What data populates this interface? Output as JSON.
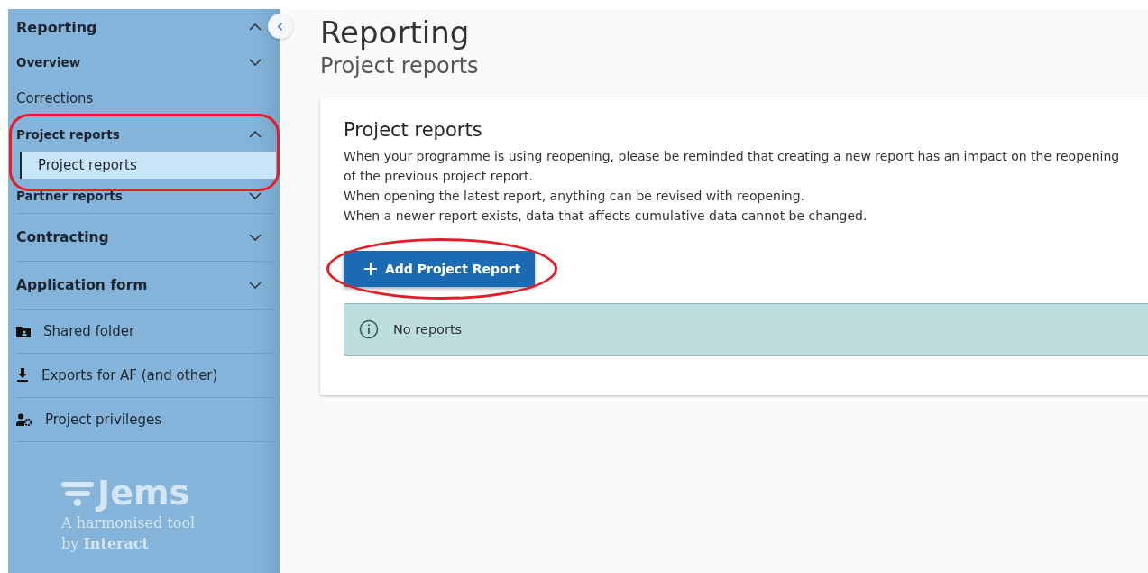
{
  "sidebar": {
    "sections": [
      {
        "label": "Reporting",
        "kind": "group",
        "expanded": true,
        "children": [
          {
            "label": "Overview",
            "kind": "group",
            "expanded": false
          },
          {
            "label": "Corrections",
            "kind": "link",
            "selected": false
          },
          {
            "label": "Project reports",
            "kind": "group",
            "expanded": true,
            "children": [
              {
                "label": "Project reports",
                "kind": "link",
                "selected": true
              }
            ]
          },
          {
            "label": "Partner reports",
            "kind": "group",
            "expanded": false
          }
        ]
      },
      {
        "label": "Contracting",
        "kind": "group",
        "expanded": false
      },
      {
        "label": "Application form",
        "kind": "group",
        "expanded": false
      },
      {
        "label": "Shared folder",
        "kind": "folder"
      },
      {
        "label": "Exports for AF (and other)",
        "kind": "download"
      },
      {
        "label": "Project privileges",
        "kind": "privileges"
      }
    ],
    "logo": {
      "name": "Jems",
      "tagline": [
        "A harmonised tool",
        "by **Interact**"
      ]
    }
  },
  "page": {
    "title": "Reporting",
    "subtitle": "Project reports"
  },
  "card": {
    "heading": "Project reports",
    "paragraphs": [
      "When your programme is using reopening, please be reminded that creating a new report has an impact on the reopening of the previous project report.",
      "When opening the latest report, anything can be revised with reopening.",
      "When a newer report exists, data that affects cumulative data cannot be changed."
    ],
    "button": "Add Project Report",
    "alert": "No reports"
  }
}
